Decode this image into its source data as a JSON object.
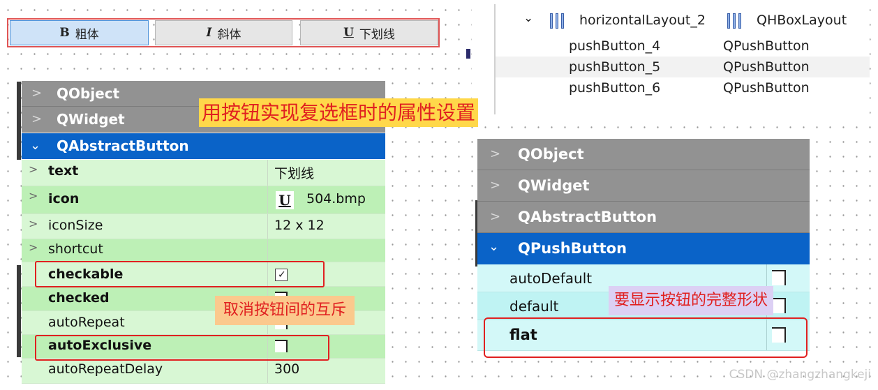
{
  "toolbar": {
    "buttons": [
      {
        "glyph": "B",
        "label": "粗体"
      },
      {
        "glyph": "I",
        "label": "斜体"
      },
      {
        "glyph": "U",
        "label": "下划线"
      }
    ]
  },
  "object_tree": {
    "layout": {
      "name": "horizontalLayout_2",
      "class": "QHBoxLayout"
    },
    "children": [
      {
        "name": "pushButton_4",
        "class": "QPushButton"
      },
      {
        "name": "pushButton_5",
        "class": "QPushButton"
      },
      {
        "name": "pushButton_6",
        "class": "QPushButton"
      }
    ]
  },
  "left_editor": {
    "sections": [
      "QObject",
      "QWidget",
      "QAbstractButton"
    ],
    "rows": [
      {
        "name": "text",
        "value": "下划线"
      },
      {
        "name": "icon",
        "icon_glyph": "U",
        "value": "504.bmp"
      },
      {
        "name": "iconSize",
        "value": "12 x 12"
      },
      {
        "name": "shortcut",
        "value": ""
      },
      {
        "name": "checkable",
        "value": "checked"
      },
      {
        "name": "checked",
        "value": "unchecked"
      },
      {
        "name": "autoRepeat",
        "value": "unchecked"
      },
      {
        "name": "autoExclusive",
        "value": "unchecked"
      },
      {
        "name": "autoRepeatDelay",
        "value": "300"
      }
    ]
  },
  "right_editor": {
    "sections": [
      "QObject",
      "QWidget",
      "QAbstractButton",
      "QPushButton"
    ],
    "rows": [
      {
        "name": "autoDefault",
        "value": "unchecked"
      },
      {
        "name": "default",
        "value": "unchecked"
      },
      {
        "name": "flat",
        "value": "unchecked"
      }
    ]
  },
  "annotations": {
    "checkbox_note": "用按钮实现复选框时的属性设置",
    "exclusive_note": "取消按钮间的互斥",
    "flat_note": "要显示按钮的完整形状"
  },
  "watermark": "CSDN @zhangzhangkeji",
  "colors": {
    "section_header": "#929292",
    "section_open": "#0a63c8",
    "row_green": "#d8f7d4",
    "row_cyan": "#d3f8f8",
    "highlight_border": "#e02020"
  }
}
